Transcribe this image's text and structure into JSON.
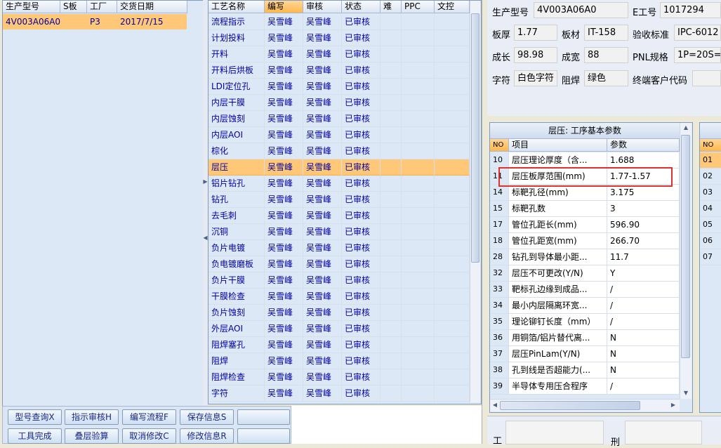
{
  "panel1": {
    "columns": [
      "生产型号",
      "S板",
      "工厂",
      "交货日期"
    ],
    "rows": [
      [
        "4V003A06A0",
        "",
        "P3",
        "2017/7/15"
      ]
    ]
  },
  "panel2": {
    "columns": [
      "工艺名称",
      "编写",
      "审核",
      "状态",
      "难",
      "PPC",
      "文控"
    ],
    "rows": [
      [
        "流程指示",
        "吴雪峰",
        "吴雪峰",
        "已审核"
      ],
      [
        "计划投料",
        "吴雪峰",
        "吴雪峰",
        "已审核"
      ],
      [
        "开料",
        "吴雪峰",
        "吴雪峰",
        "已审核"
      ],
      [
        "开料后烘板",
        "吴雪峰",
        "吴雪峰",
        "已审核"
      ],
      [
        "LDI定位孔",
        "吴雪峰",
        "吴雪峰",
        "已审核"
      ],
      [
        "内层干膜",
        "吴雪峰",
        "吴雪峰",
        "已审核"
      ],
      [
        "内层蚀刻",
        "吴雪峰",
        "吴雪峰",
        "已审核"
      ],
      [
        "内层AOI",
        "吴雪峰",
        "吴雪峰",
        "已审核"
      ],
      [
        "棕化",
        "吴雪峰",
        "吴雪峰",
        "已审核"
      ],
      [
        "层压",
        "吴雪峰",
        "吴雪峰",
        "已审核"
      ],
      [
        "铝片钻孔",
        "吴雪峰",
        "吴雪峰",
        "已审核"
      ],
      [
        "钻孔",
        "吴雪峰",
        "吴雪峰",
        "已审核"
      ],
      [
        "去毛刺",
        "吴雪峰",
        "吴雪峰",
        "已审核"
      ],
      [
        "沉铜",
        "吴雪峰",
        "吴雪峰",
        "已审核"
      ],
      [
        "负片电镀",
        "吴雪峰",
        "吴雪峰",
        "已审核"
      ],
      [
        "负电镀磨板",
        "吴雪峰",
        "吴雪峰",
        "已审核"
      ],
      [
        "负片干膜",
        "吴雪峰",
        "吴雪峰",
        "已审核"
      ],
      [
        "干膜检查",
        "吴雪峰",
        "吴雪峰",
        "已审核"
      ],
      [
        "负片蚀刻",
        "吴雪峰",
        "吴雪峰",
        "已审核"
      ],
      [
        "外层AOI",
        "吴雪峰",
        "吴雪峰",
        "已审核"
      ],
      [
        "阻焊塞孔",
        "吴雪峰",
        "吴雪峰",
        "已审核"
      ],
      [
        "阻焊",
        "吴雪峰",
        "吴雪峰",
        "已审核"
      ],
      [
        "阻焊检查",
        "吴雪峰",
        "吴雪峰",
        "已审核"
      ],
      [
        "字符",
        "吴雪峰",
        "吴雪峰",
        "已审核"
      ]
    ],
    "selected_index": 9
  },
  "info": {
    "model_label": "生产型号",
    "model_value": "4V003A06A0",
    "eno_label": "E工号",
    "eno_value": "1017294",
    "thick_label": "板厚",
    "thick_value": "1.77",
    "material_label": "板材",
    "material_value": "IT-158",
    "std_label": "验收标准",
    "std_value": "IPC-6012",
    "len_label": "成长",
    "len_value": "98.98",
    "width_label": "成宽",
    "width_value": "88",
    "pnl_label": "PNL规格",
    "pnl_value": "1P=20S=",
    "char_label": "字符",
    "char_value": "白色字符",
    "mask_label": "阻焊",
    "mask_value": "绿色",
    "customer_label": "终端客户代码",
    "customer_value": ""
  },
  "params": {
    "title": "层压: 工序基本参数",
    "columns": [
      "NO",
      "项目",
      "参数"
    ],
    "rows": [
      [
        "10",
        "层压理论厚度（含...",
        "1.688"
      ],
      [
        "11",
        "层压板厚范围(mm)",
        "1.77-1.57"
      ],
      [
        "14",
        "标靶孔径(mm)",
        "3.175"
      ],
      [
        "15",
        "标靶孔数",
        "3"
      ],
      [
        "17",
        "管位孔距长(mm)",
        "596.90"
      ],
      [
        "18",
        "管位孔距宽(mm)",
        "266.70"
      ],
      [
        "28",
        "钻孔到导体最小距...",
        "11.7"
      ],
      [
        "32",
        "层压不可更改(Y/N)",
        "Y"
      ],
      [
        "33",
        "靶标孔边缘到成品...",
        "/"
      ],
      [
        "34",
        "最小内层隔离环宽...",
        "/"
      ],
      [
        "35",
        "理论铆钉长度（mm）",
        "/"
      ],
      [
        "36",
        "用铜箔/铝片替代离...",
        "N"
      ],
      [
        "37",
        "层压PinLam(Y/N)",
        "N"
      ],
      [
        "38",
        "孔到线是否超能力(...",
        "N"
      ],
      [
        "39",
        "半导体专用压合程序",
        "/"
      ]
    ],
    "highlight_index": 1
  },
  "right_list": {
    "column": "NO",
    "rows": [
      "01",
      "02",
      "03",
      "04",
      "05",
      "06",
      "07"
    ]
  },
  "buttons": {
    "row1": [
      "型号查询X",
      "指示审核H",
      "编写流程F",
      "保存信息S",
      ""
    ],
    "row2": [
      "工具完成",
      "叠层验算",
      "取消修改C",
      "修改信息R",
      ""
    ]
  },
  "bottom": {
    "label_a": "工",
    "label_b": "刑"
  },
  "colors": {
    "selected_row": "#ffc778",
    "highlight_box": "#e0312e",
    "header": "#dbe5f3"
  }
}
